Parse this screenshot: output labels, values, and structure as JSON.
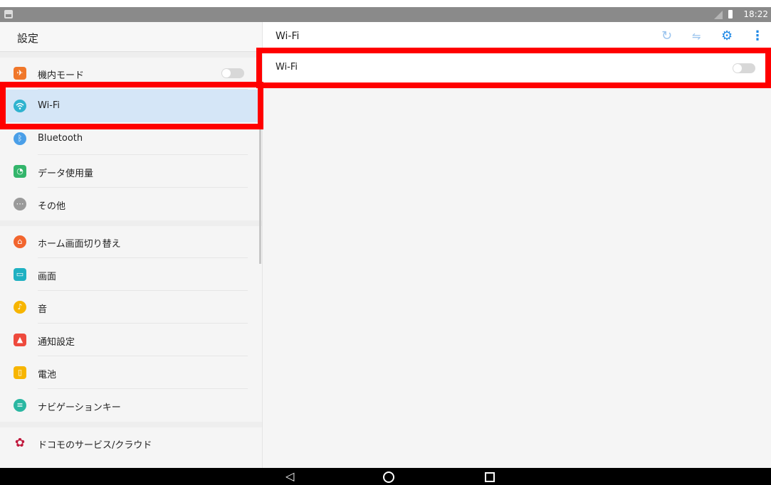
{
  "status_bar": {
    "time": "18:22"
  },
  "settings_pane": {
    "title": "設定",
    "items": [
      {
        "label": "機内モード",
        "icon": "airplane-icon",
        "color": "#f0772a"
      },
      {
        "label": "Wi-Fi",
        "icon": "wifi-icon",
        "color": "#2fb3cf",
        "selected": true
      },
      {
        "label": "Bluetooth",
        "icon": "bluetooth-icon",
        "color": "#4a9fe8"
      },
      {
        "label": "データ使用量",
        "icon": "data-usage-icon",
        "color": "#33b56b"
      },
      {
        "label": "その他",
        "icon": "more-icon",
        "color": "#9a9a9a"
      },
      {
        "label": "ホーム画面切り替え",
        "icon": "home-icon",
        "color": "#f2652e"
      },
      {
        "label": "画面",
        "icon": "display-icon",
        "color": "#1fb1c2"
      },
      {
        "label": "音",
        "icon": "sound-icon",
        "color": "#f7b500"
      },
      {
        "label": "通知設定",
        "icon": "notification-icon",
        "color": "#ee4a3d"
      },
      {
        "label": "電池",
        "icon": "battery-icon",
        "color": "#f7b500"
      },
      {
        "label": "ナビゲーションキー",
        "icon": "navigation-key-icon",
        "color": "#2ab7a2"
      },
      {
        "label": "ドコモのサービス/クラウド",
        "icon": "docomo-service-icon",
        "color": "#c0183c"
      }
    ],
    "airplane_mode_on": false
  },
  "detail_pane": {
    "title": "Wi-Fi",
    "row_label": "Wi-Fi",
    "wifi_on": false,
    "header_icons": [
      "refresh-icon",
      "wifi-direct-icon",
      "advanced-settings-icon",
      "more-options-icon"
    ]
  },
  "colors": {
    "accent": "#1e88e5",
    "highlight": "#ff0000",
    "selected_bg": "#d5e6f7"
  }
}
